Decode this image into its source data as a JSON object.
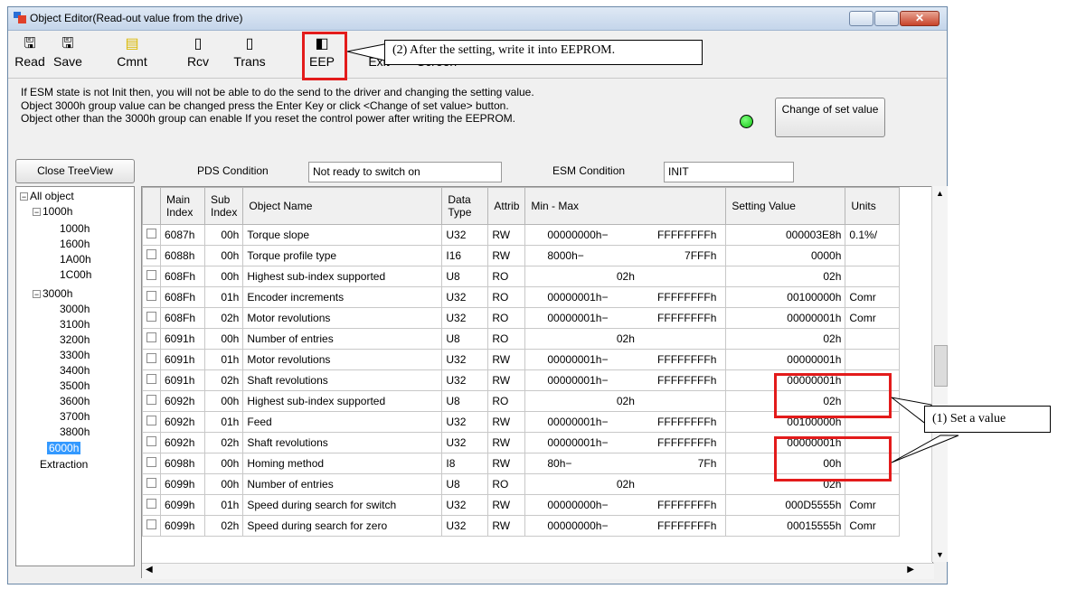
{
  "window": {
    "title": "Object Editor(Read-out value from the drive)"
  },
  "toolbar": {
    "read": "Read",
    "save": "Save",
    "cmnt": "Cmnt",
    "rcv": "Rcv",
    "trans": "Trans",
    "eep": "EEP",
    "exit": "Exit",
    "screen": "Screen"
  },
  "info": {
    "line1": "If ESM state is not Init then, you will not be able to do the send to the driver and changing the setting value.",
    "line2": "Object 3000h group value can be changed press the Enter Key or click <Change of set value> button.",
    "line3": "Object other than the 3000h group can enable If you reset the control power after writing the EEPROM."
  },
  "change_button": "Change of set value",
  "close_treeview": "Close TreeView",
  "pds": {
    "label": "PDS Condition",
    "value": "Not ready to switch on"
  },
  "esm": {
    "label": "ESM Condition",
    "value": "INIT"
  },
  "tree": {
    "root": "All object",
    "g1000": "1000h",
    "i1000": "1000h",
    "i1600": "1600h",
    "i1A00": "1A00h",
    "i1C00": "1C00h",
    "g3000": "3000h",
    "i3000": "3000h",
    "i3100": "3100h",
    "i3200": "3200h",
    "i3300": "3300h",
    "i3400": "3400h",
    "i3500": "3500h",
    "i3600": "3600h",
    "i3700": "3700h",
    "i3800": "3800h",
    "i6000": "6000h",
    "extraction": "Extraction"
  },
  "columns": {
    "main": "Main Index",
    "sub": "Sub Index",
    "name": "Object Name",
    "type": "Data Type",
    "attrib": "Attrib",
    "minmax": "Min - Max",
    "setting": "Setting Value",
    "units": "Units"
  },
  "rows": [
    {
      "main": "6087h",
      "sub": "00h",
      "name": "Torque slope",
      "type": "U32",
      "attrib": "RW",
      "min": "00000000h−",
      "max": "FFFFFFFFh",
      "value": "000003E8h",
      "units": "0.1%/"
    },
    {
      "main": "6088h",
      "sub": "00h",
      "name": "Torque profile type",
      "type": "I16",
      "attrib": "RW",
      "min": "8000h−",
      "max": "7FFFh",
      "value": "0000h",
      "units": ""
    },
    {
      "main": "608Fh",
      "sub": "00h",
      "name": "Highest sub-index supported",
      "type": "U8",
      "attrib": "RO",
      "min": "02h",
      "max": "",
      "value": "02h",
      "units": ""
    },
    {
      "main": "608Fh",
      "sub": "01h",
      "name": "Encoder increments",
      "type": "U32",
      "attrib": "RO",
      "min": "00000001h−",
      "max": "FFFFFFFFh",
      "value": "00100000h",
      "units": "Comr"
    },
    {
      "main": "608Fh",
      "sub": "02h",
      "name": "Motor revolutions",
      "type": "U32",
      "attrib": "RO",
      "min": "00000001h−",
      "max": "FFFFFFFFh",
      "value": "00000001h",
      "units": "Comr"
    },
    {
      "main": "6091h",
      "sub": "00h",
      "name": "Number of entries",
      "type": "U8",
      "attrib": "RO",
      "min": "02h",
      "max": "",
      "value": "02h",
      "units": ""
    },
    {
      "main": "6091h",
      "sub": "01h",
      "name": "Motor revolutions",
      "type": "U32",
      "attrib": "RW",
      "min": "00000001h−",
      "max": "FFFFFFFFh",
      "value": "00000001h",
      "units": ""
    },
    {
      "main": "6091h",
      "sub": "02h",
      "name": "Shaft revolutions",
      "type": "U32",
      "attrib": "RW",
      "min": "00000001h−",
      "max": "FFFFFFFFh",
      "value": "00000001h",
      "units": ""
    },
    {
      "main": "6092h",
      "sub": "00h",
      "name": "Highest sub-index supported",
      "type": "U8",
      "attrib": "RO",
      "min": "02h",
      "max": "",
      "value": "02h",
      "units": ""
    },
    {
      "main": "6092h",
      "sub": "01h",
      "name": "Feed",
      "type": "U32",
      "attrib": "RW",
      "min": "00000001h−",
      "max": "FFFFFFFFh",
      "value": "00100000h",
      "units": ""
    },
    {
      "main": "6092h",
      "sub": "02h",
      "name": "Shaft revolutions",
      "type": "U32",
      "attrib": "RW",
      "min": "00000001h−",
      "max": "FFFFFFFFh",
      "value": "00000001h",
      "units": ""
    },
    {
      "main": "6098h",
      "sub": "00h",
      "name": "Homing method",
      "type": "I8",
      "attrib": "RW",
      "min": "80h−",
      "max": "7Fh",
      "value": "00h",
      "units": ""
    },
    {
      "main": "6099h",
      "sub": "00h",
      "name": "Number of entries",
      "type": "U8",
      "attrib": "RO",
      "min": "02h",
      "max": "",
      "value": "02h",
      "units": ""
    },
    {
      "main": "6099h",
      "sub": "01h",
      "name": "Speed during search for switch",
      "type": "U32",
      "attrib": "RW",
      "min": "00000000h−",
      "max": "FFFFFFFFh",
      "value": "000D5555h",
      "units": "Comr"
    },
    {
      "main": "6099h",
      "sub": "02h",
      "name": "Speed during search for zero",
      "type": "U32",
      "attrib": "RW",
      "min": "00000000h−",
      "max": "FFFFFFFFh",
      "value": "00015555h",
      "units": "Comr"
    }
  ],
  "annotations": {
    "eep_note": "(2) After the setting, write it into EEPROM.",
    "value_note": "(1) Set a value"
  },
  "colors": {
    "highlight": "#e31b1b",
    "led": "#12c312",
    "selection": "#3399ff"
  }
}
